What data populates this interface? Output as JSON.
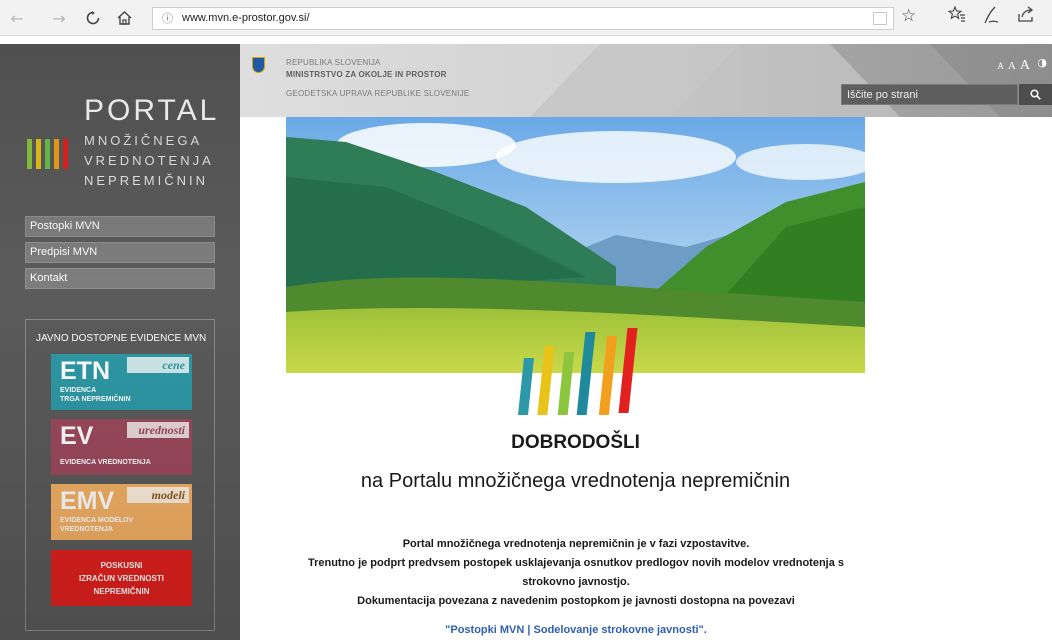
{
  "browser": {
    "back_icon": "arrow-left-icon",
    "forward_icon": "arrow-right-icon",
    "refresh_icon": "refresh-icon",
    "home_icon": "home-icon",
    "info_icon": "info-icon",
    "url": "www.mvn.e-prostor.gov.si/",
    "toolbar_icons": [
      "reading-view-icon",
      "favorite-star-icon",
      "favorites-list-icon",
      "pen-icon",
      "share-icon"
    ]
  },
  "header": {
    "line1": "REPUBLIKA SLOVENIJA",
    "line2": "MINISTRSTVO ZA OKOLJE IN PROSTOR",
    "line3": "GEODETSKA UPRAVA REPUBLIKE SLOVENIJE",
    "font_small": "A",
    "font_medium": "A",
    "font_large": "A",
    "contrast_icon": "contrast-icon",
    "search_placeholder": "Iščite po strani",
    "search_icon": "search-icon"
  },
  "sidebar": {
    "logo": {
      "portal": "PORTAL",
      "line1": "MNOŽIČNEGA",
      "line2": "VREDNOTENJA",
      "line3": "NEPREMIČNIN",
      "stripe_colors": [
        "#8cc63f",
        "#e8c31a",
        "#6dbf4b",
        "#f0a01c",
        "#e2211f"
      ]
    },
    "menu": [
      {
        "label": "Postopki MVN"
      },
      {
        "label": "Predpisi MVN"
      },
      {
        "label": "Kontakt"
      }
    ],
    "evidence": {
      "title": "JAVNO DOSTOPNE EVIDENCE MVN",
      "cards": [
        {
          "abbr": "ETN",
          "tag": "cene",
          "sub1": "EVIDENCA",
          "sub2": "TRGA NEPREMIČNIN",
          "color": "#2e99a6",
          "tag_color": "#2e99a6"
        },
        {
          "abbr": "EV",
          "tag": "urednosti",
          "sub1": "EVIDENCA VREDNOTENJA",
          "sub2": "",
          "color": "#9c4a5c",
          "tag_color": "#9c4a5c"
        },
        {
          "abbr": "EMV",
          "tag": "modeli",
          "sub1": "EVIDENCA MODELOV",
          "sub2": "VREDNOTENJA",
          "color": "#f3b165",
          "tag_color": "#8a5a1c"
        }
      ],
      "calc": {
        "line1": "POSKUSNI",
        "line2": "IZRAČUN VREDNOSTI",
        "line3": "NEPREMIČNIN",
        "color": "#e2211f"
      }
    }
  },
  "main": {
    "bar_colors": [
      "#2e99a6",
      "#e8c31a",
      "#8cc63f",
      "#1f8a9b",
      "#f0a01c",
      "#e2211f"
    ],
    "welcome_title": "DOBRODOŠLI",
    "welcome_subtitle": "na Portalu množičnega vrednotenja nepremičnin",
    "paragraph": [
      "Portal množičnega vrednotenja nepremičnin je v fazi vzpostavitve.",
      "Trenutno je podprt predvsem postopek usklajevanja osnutkov predlogov novih modelov vrednotenja s",
      "strokovno javnostjo.",
      "Dokumentacija povezana z navedenim postopkom je javnosti dostopna na povezavi"
    ],
    "link_text": "\"Postopki MVN | Sodelovanje strokovne javnosti\"."
  }
}
